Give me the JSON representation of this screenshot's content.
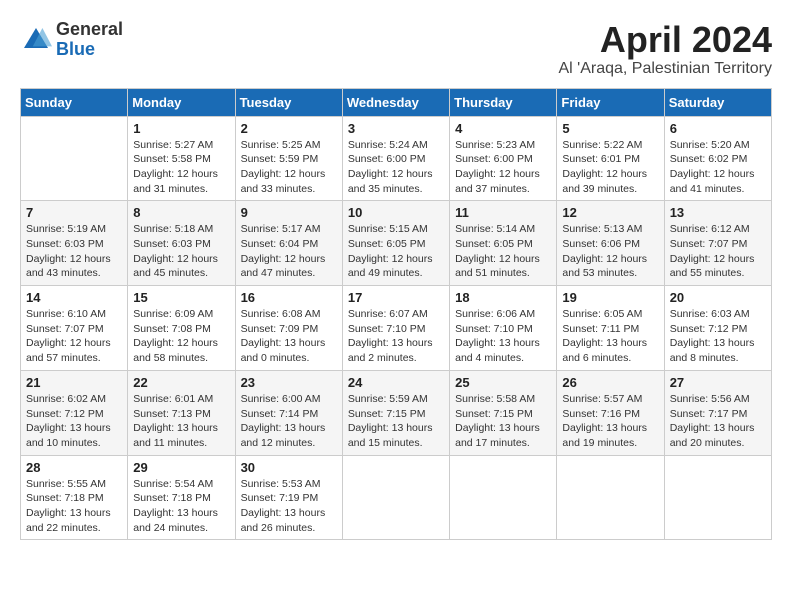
{
  "logo": {
    "general": "General",
    "blue": "Blue"
  },
  "title": "April 2024",
  "location": "Al 'Araqa, Palestinian Territory",
  "weekdays": [
    "Sunday",
    "Monday",
    "Tuesday",
    "Wednesday",
    "Thursday",
    "Friday",
    "Saturday"
  ],
  "weeks": [
    [
      {
        "day": null,
        "info": null
      },
      {
        "day": "1",
        "info": "Sunrise: 5:27 AM\nSunset: 5:58 PM\nDaylight: 12 hours\nand 31 minutes."
      },
      {
        "day": "2",
        "info": "Sunrise: 5:25 AM\nSunset: 5:59 PM\nDaylight: 12 hours\nand 33 minutes."
      },
      {
        "day": "3",
        "info": "Sunrise: 5:24 AM\nSunset: 6:00 PM\nDaylight: 12 hours\nand 35 minutes."
      },
      {
        "day": "4",
        "info": "Sunrise: 5:23 AM\nSunset: 6:00 PM\nDaylight: 12 hours\nand 37 minutes."
      },
      {
        "day": "5",
        "info": "Sunrise: 5:22 AM\nSunset: 6:01 PM\nDaylight: 12 hours\nand 39 minutes."
      },
      {
        "day": "6",
        "info": "Sunrise: 5:20 AM\nSunset: 6:02 PM\nDaylight: 12 hours\nand 41 minutes."
      }
    ],
    [
      {
        "day": "7",
        "info": "Sunrise: 5:19 AM\nSunset: 6:03 PM\nDaylight: 12 hours\nand 43 minutes."
      },
      {
        "day": "8",
        "info": "Sunrise: 5:18 AM\nSunset: 6:03 PM\nDaylight: 12 hours\nand 45 minutes."
      },
      {
        "day": "9",
        "info": "Sunrise: 5:17 AM\nSunset: 6:04 PM\nDaylight: 12 hours\nand 47 minutes."
      },
      {
        "day": "10",
        "info": "Sunrise: 5:15 AM\nSunset: 6:05 PM\nDaylight: 12 hours\nand 49 minutes."
      },
      {
        "day": "11",
        "info": "Sunrise: 5:14 AM\nSunset: 6:05 PM\nDaylight: 12 hours\nand 51 minutes."
      },
      {
        "day": "12",
        "info": "Sunrise: 5:13 AM\nSunset: 6:06 PM\nDaylight: 12 hours\nand 53 minutes."
      },
      {
        "day": "13",
        "info": "Sunrise: 6:12 AM\nSunset: 7:07 PM\nDaylight: 12 hours\nand 55 minutes."
      }
    ],
    [
      {
        "day": "14",
        "info": "Sunrise: 6:10 AM\nSunset: 7:07 PM\nDaylight: 12 hours\nand 57 minutes."
      },
      {
        "day": "15",
        "info": "Sunrise: 6:09 AM\nSunset: 7:08 PM\nDaylight: 12 hours\nand 58 minutes."
      },
      {
        "day": "16",
        "info": "Sunrise: 6:08 AM\nSunset: 7:09 PM\nDaylight: 13 hours\nand 0 minutes."
      },
      {
        "day": "17",
        "info": "Sunrise: 6:07 AM\nSunset: 7:10 PM\nDaylight: 13 hours\nand 2 minutes."
      },
      {
        "day": "18",
        "info": "Sunrise: 6:06 AM\nSunset: 7:10 PM\nDaylight: 13 hours\nand 4 minutes."
      },
      {
        "day": "19",
        "info": "Sunrise: 6:05 AM\nSunset: 7:11 PM\nDaylight: 13 hours\nand 6 minutes."
      },
      {
        "day": "20",
        "info": "Sunrise: 6:03 AM\nSunset: 7:12 PM\nDaylight: 13 hours\nand 8 minutes."
      }
    ],
    [
      {
        "day": "21",
        "info": "Sunrise: 6:02 AM\nSunset: 7:12 PM\nDaylight: 13 hours\nand 10 minutes."
      },
      {
        "day": "22",
        "info": "Sunrise: 6:01 AM\nSunset: 7:13 PM\nDaylight: 13 hours\nand 11 minutes."
      },
      {
        "day": "23",
        "info": "Sunrise: 6:00 AM\nSunset: 7:14 PM\nDaylight: 13 hours\nand 12 minutes."
      },
      {
        "day": "24",
        "info": "Sunrise: 5:59 AM\nSunset: 7:15 PM\nDaylight: 13 hours\nand 15 minutes."
      },
      {
        "day": "25",
        "info": "Sunrise: 5:58 AM\nSunset: 7:15 PM\nDaylight: 13 hours\nand 17 minutes."
      },
      {
        "day": "26",
        "info": "Sunrise: 5:57 AM\nSunset: 7:16 PM\nDaylight: 13 hours\nand 19 minutes."
      },
      {
        "day": "27",
        "info": "Sunrise: 5:56 AM\nSunset: 7:17 PM\nDaylight: 13 hours\nand 20 minutes."
      }
    ],
    [
      {
        "day": "28",
        "info": "Sunrise: 5:55 AM\nSunset: 7:18 PM\nDaylight: 13 hours\nand 22 minutes."
      },
      {
        "day": "29",
        "info": "Sunrise: 5:54 AM\nSunset: 7:18 PM\nDaylight: 13 hours\nand 24 minutes."
      },
      {
        "day": "30",
        "info": "Sunrise: 5:53 AM\nSunset: 7:19 PM\nDaylight: 13 hours\nand 26 minutes."
      },
      {
        "day": null,
        "info": null
      },
      {
        "day": null,
        "info": null
      },
      {
        "day": null,
        "info": null
      },
      {
        "day": null,
        "info": null
      }
    ]
  ]
}
